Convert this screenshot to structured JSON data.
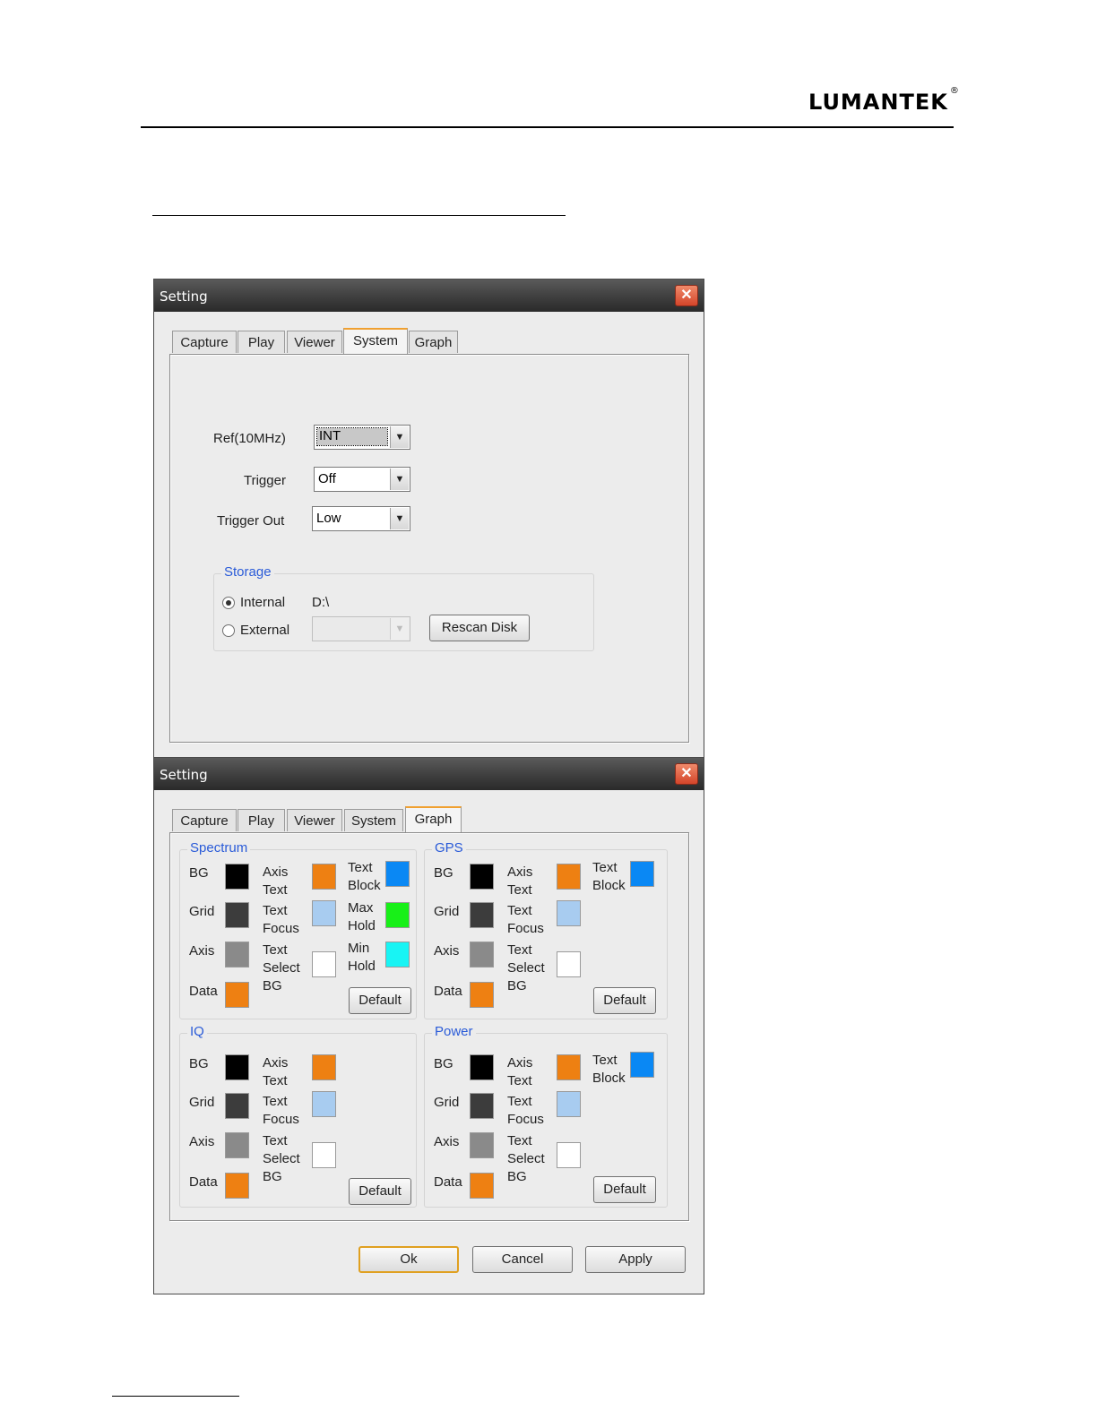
{
  "header": {
    "logo": "LUMANTEK",
    "reg": "®"
  },
  "win1": {
    "title": "Setting",
    "close": "✕",
    "tabs": [
      "Capture",
      "Play",
      "Viewer",
      "System",
      "Graph"
    ],
    "ref_label": "Ref(10MHz)",
    "ref_value": "INT",
    "trigger_label": "Trigger",
    "trigger_value": "Off",
    "trigger_out_label": "Trigger Out",
    "trigger_out_value": "Low",
    "storage": {
      "title": "Storage",
      "internal_label": "Internal",
      "internal_path": "D:\\",
      "external_label": "External",
      "rescan_label": "Rescan Disk"
    }
  },
  "win2": {
    "title": "Setting",
    "close": "✕",
    "tabs": [
      "Capture",
      "Play",
      "Viewer",
      "System",
      "Graph"
    ],
    "spectrum": {
      "title": "Spectrum",
      "bg": "BG",
      "grid": "Grid",
      "axis": "Axis",
      "data": "Data",
      "axis_text": [
        "Axis",
        "Text"
      ],
      "text_focus": [
        "Text",
        "Focus"
      ],
      "text_select": [
        "Text",
        "Select",
        "BG"
      ],
      "text_block": [
        "Text",
        "Block"
      ],
      "max_hold": [
        "Max",
        "Hold"
      ],
      "min_hold": [
        "Min",
        "Hold"
      ],
      "default": "Default"
    },
    "gps": {
      "title": "GPS",
      "bg": "BG",
      "grid": "Grid",
      "axis": "Axis",
      "data": "Data",
      "axis_text": [
        "Axis",
        "Text"
      ],
      "text_focus": [
        "Text",
        "Focus"
      ],
      "text_select": [
        "Text",
        "Select",
        "BG"
      ],
      "text_block": [
        "Text",
        "Block"
      ],
      "default": "Default"
    },
    "iq": {
      "title": "IQ",
      "bg": "BG",
      "grid": "Grid",
      "axis": "Axis",
      "data": "Data",
      "axis_text": [
        "Axis",
        "Text"
      ],
      "text_focus": [
        "Text",
        "Focus"
      ],
      "text_select": [
        "Text",
        "Select",
        "BG"
      ],
      "default": "Default"
    },
    "power": {
      "title": "Power",
      "bg": "BG",
      "grid": "Grid",
      "axis": "Axis",
      "data": "Data",
      "axis_text": [
        "Axis",
        "Text"
      ],
      "text_focus": [
        "Text",
        "Focus"
      ],
      "text_select": [
        "Text",
        "Select",
        "BG"
      ],
      "text_block": [
        "Text",
        "Block"
      ],
      "default": "Default"
    },
    "ok": "Ok",
    "cancel": "Cancel",
    "apply": "Apply"
  },
  "colors": {
    "bg": "#000000",
    "grid": "#3c3c3c",
    "axis": "#8a8a8a",
    "data": "#ee8012",
    "axis_text": "#ee8012",
    "text_focus": "#a8ccf0",
    "text_select": "#ffffff",
    "text_block": "#0a88f4",
    "max_hold": "#18f018",
    "min_hold": "#18f4f4"
  }
}
